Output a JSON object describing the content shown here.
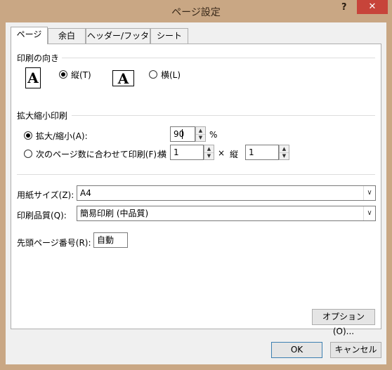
{
  "dialog": {
    "title": "ページ設定",
    "help": "?",
    "close": "✕"
  },
  "tabs": [
    {
      "label": "ページ",
      "active": true
    },
    {
      "label": "余白",
      "active": false
    },
    {
      "label": "ヘッダー/フッター",
      "active": false
    },
    {
      "label": "シート",
      "active": false
    }
  ],
  "orientation": {
    "group_label": "印刷の向き",
    "icon_letter": "A",
    "portrait_label": "縦(T)",
    "landscape_label": "横(L)",
    "selected": "portrait"
  },
  "scaling": {
    "group_label": "拡大縮小印刷",
    "adjust_label": "拡大/縮小(A):",
    "adjust_value": "90",
    "percent_sign": "%",
    "fit_label": "次のページ数に合わせて印刷(F):",
    "wide_label": "横",
    "wide_value": "1",
    "times_sign": "×",
    "tall_label": "縦",
    "tall_value": "1",
    "selected": "adjust"
  },
  "paper_size": {
    "label": "用紙サイズ(Z):",
    "value": "A4"
  },
  "print_quality": {
    "label": "印刷品質(Q):",
    "value": "簡易印刷 (中品質)"
  },
  "first_page": {
    "label": "先頭ページ番号(R):",
    "value": "自動"
  },
  "buttons": {
    "options": "オプション(O)...",
    "ok": "OK",
    "cancel": "キャンセル"
  }
}
